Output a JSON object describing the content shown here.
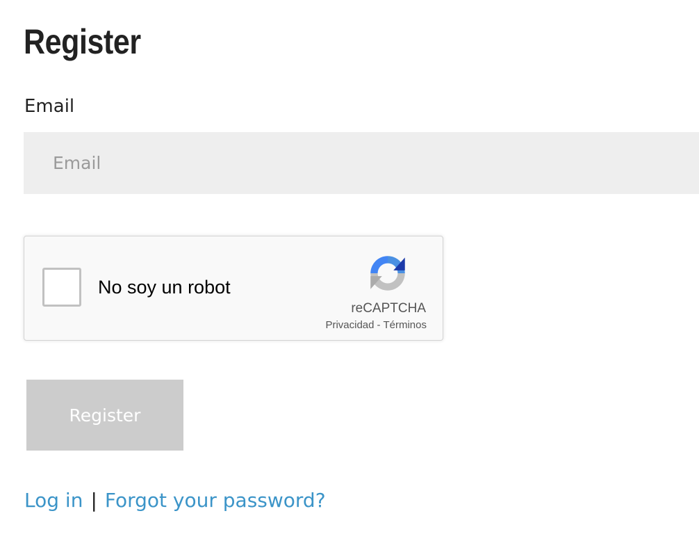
{
  "page": {
    "title": "Register"
  },
  "form": {
    "email_label": "Email",
    "email_placeholder": "Email",
    "email_value": "",
    "submit_label": "Register"
  },
  "recaptcha": {
    "label": "No soy un robot",
    "brand": "reCAPTCHA",
    "privacy_label": "Privacidad",
    "separator": "-",
    "terms_label": "Términos",
    "checked": false,
    "icon": "recaptcha-logo"
  },
  "links": {
    "login_label": "Log in",
    "separator": "|",
    "forgot_password_label": "Forgot your password?"
  },
  "colors": {
    "link": "#3b94c8",
    "button_disabled_bg": "#cccccc",
    "input_bg": "#eeeeee",
    "text": "#222222"
  }
}
